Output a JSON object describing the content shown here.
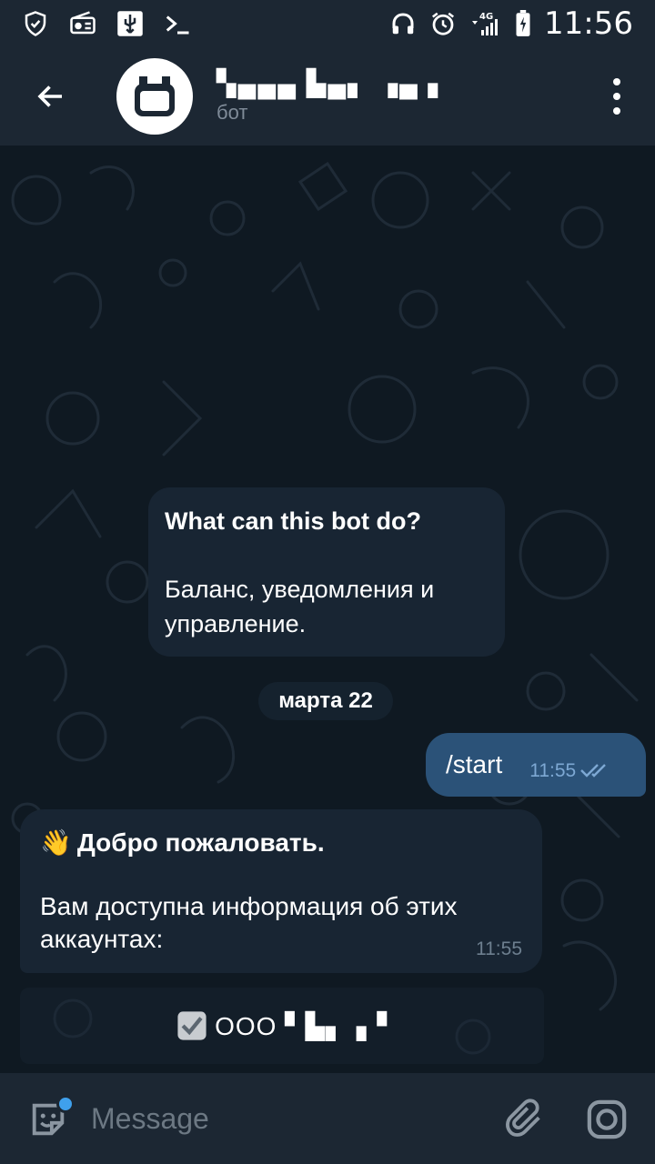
{
  "status_bar": {
    "time": "11:56",
    "network": "4G",
    "icons": [
      "shield-icon",
      "radio-icon",
      "usb-icon",
      "terminal-icon",
      "headphones-icon",
      "alarm-icon",
      "signal-icon",
      "battery-icon"
    ]
  },
  "header": {
    "title": "▚▄▄▄ ▙▄▖ ▗▄ ▖",
    "subtitle": "бот",
    "back_icon": "arrow-left-icon",
    "menu_icon": "more-vertical-icon"
  },
  "info_card": {
    "title": "What can this bot do?",
    "description": "Баланс, уведомления и управление."
  },
  "date_separator": "марта 22",
  "messages": [
    {
      "direction": "outgoing",
      "text": "/start",
      "time": "11:55",
      "status": "read"
    },
    {
      "direction": "incoming",
      "emoji": "👋",
      "title": "Добро пожаловать.",
      "text": "Вам доступна информация об этих аккаунтах:",
      "time": "11:55"
    }
  ],
  "keyboard_button": {
    "icon": "checkbox-icon",
    "label": "ООО ▘▙▖▗▝"
  },
  "input": {
    "placeholder": "Message"
  },
  "colors": {
    "header_bg": "#1c2733",
    "chat_bg": "#0e1621",
    "incoming_bubble": "#182533",
    "outgoing_bubble": "#2b5278",
    "accent": "#3fa0ec"
  }
}
